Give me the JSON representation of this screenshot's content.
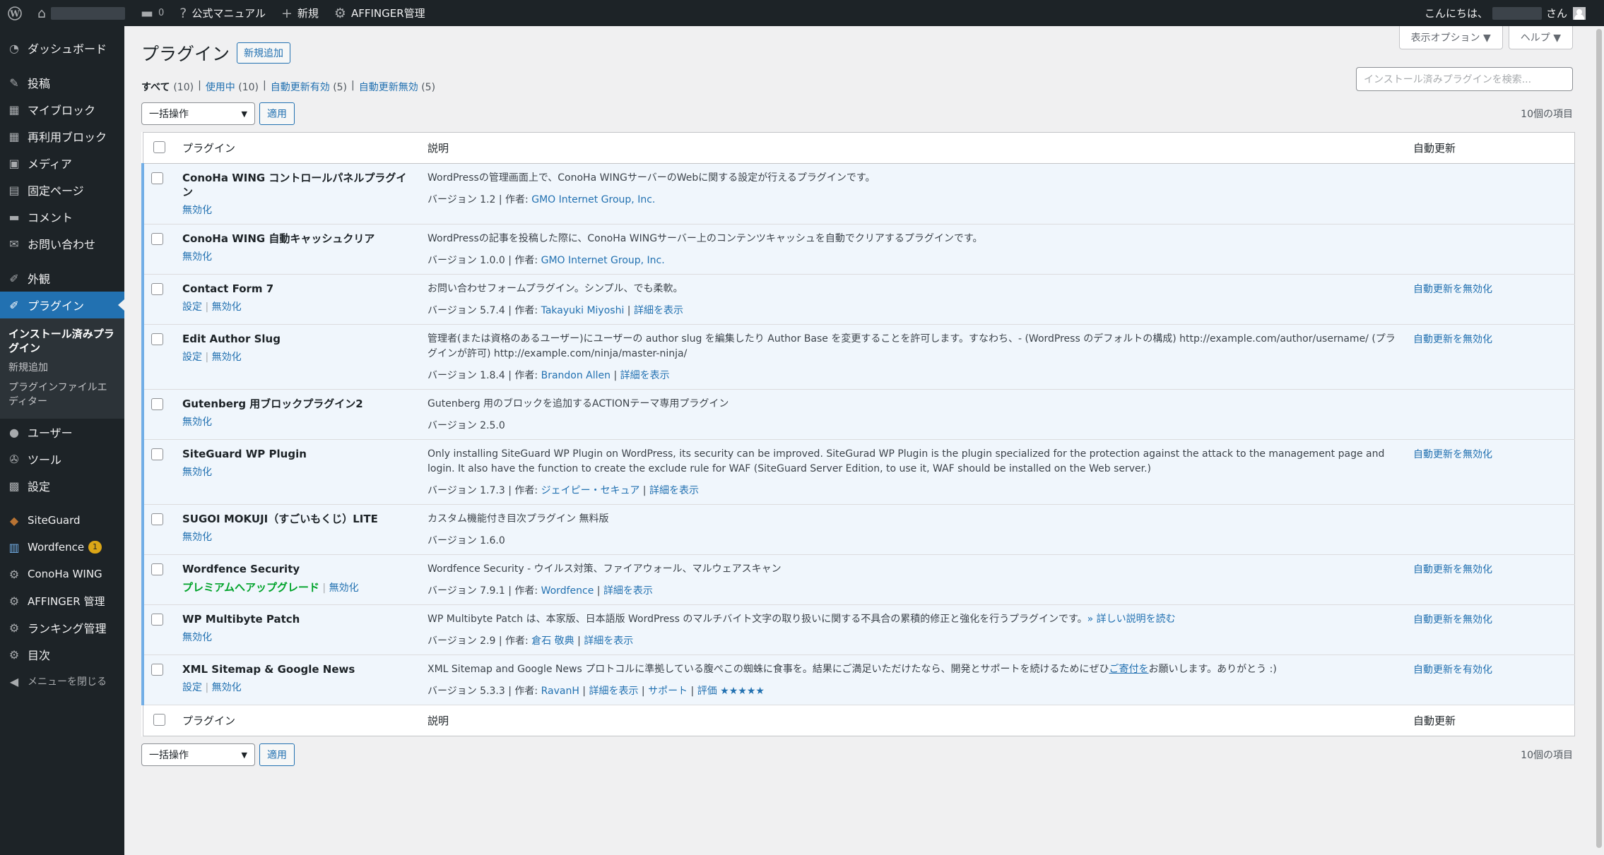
{
  "adminbar": {
    "comments_count": "0",
    "manual_label": "公式マニュアル",
    "new_label": "新規",
    "affinger_label": "AFFINGER管理",
    "greeting": "こんにちは、",
    "greeting_suffix": "さん"
  },
  "sidebar": {
    "items": [
      {
        "label": "ダッシュボード",
        "icon": "dashboard-icon",
        "glyph": "◔"
      },
      {
        "label": "投稿",
        "icon": "pin-icon",
        "glyph": "✎"
      },
      {
        "label": "マイブロック",
        "icon": "grid-icon",
        "glyph": "▦"
      },
      {
        "label": "再利用ブロック",
        "icon": "grid-icon",
        "glyph": "▦"
      },
      {
        "label": "メディア",
        "icon": "media-icon",
        "glyph": "▣"
      },
      {
        "label": "固定ページ",
        "icon": "page-icon",
        "glyph": "▤"
      },
      {
        "label": "コメント",
        "icon": "comment-icon",
        "glyph": "▬"
      },
      {
        "label": "お問い合わせ",
        "icon": "mail-icon",
        "glyph": "✉"
      },
      {
        "label": "外観",
        "icon": "brush-icon",
        "glyph": "✐"
      },
      {
        "label": "プラグイン",
        "icon": "plugin-icon",
        "glyph": "✐"
      },
      {
        "label": "ユーザー",
        "icon": "user-icon",
        "glyph": "●"
      },
      {
        "label": "ツール",
        "icon": "wrench-icon",
        "glyph": "✇"
      },
      {
        "label": "設定",
        "icon": "settings-icon",
        "glyph": "▩"
      },
      {
        "label": "SiteGuard",
        "icon": "siteguard-icon",
        "glyph": "◆"
      },
      {
        "label": "Wordfence",
        "icon": "wordfence-icon",
        "glyph": "▥",
        "badge": "1"
      },
      {
        "label": "ConoHa WING",
        "icon": "gear-icon",
        "glyph": "⚙"
      },
      {
        "label": "AFFINGER 管理",
        "icon": "gear-icon",
        "glyph": "⚙"
      },
      {
        "label": "ランキング管理",
        "icon": "gear-icon",
        "glyph": "⚙"
      },
      {
        "label": "目次",
        "icon": "gear-icon",
        "glyph": "⚙"
      },
      {
        "label": "メニューを閉じる",
        "icon": "collapse-icon",
        "glyph": "◀"
      }
    ],
    "submenu": [
      "インストール済みプラグイン",
      "新規追加",
      "プラグインファイルエディター"
    ]
  },
  "screen_meta": {
    "options": "表示オプション ▼",
    "help": "ヘルプ ▼"
  },
  "page": {
    "title": "プラグイン",
    "add_new": "新規追加",
    "filters": [
      {
        "label": "すべて",
        "count": "(10)"
      },
      {
        "label": "使用中",
        "count": "(10)"
      },
      {
        "label": "自動更新有効",
        "count": "(5)"
      },
      {
        "label": "自動更新無効",
        "count": "(5)"
      }
    ],
    "search_placeholder": "インストール済みプラグインを検索...",
    "bulk_action": "一括操作",
    "apply": "適用",
    "items_count": "10個の項目",
    "columns": {
      "plugin": "プラグイン",
      "description": "説明",
      "auto_update": "自動更新"
    }
  },
  "plugins": [
    {
      "name": "ConoHa WING コントロールパネルプラグイン",
      "actions": [
        "無効化"
      ],
      "desc": "WordPressの管理画面上で、ConoHa WINGサーバーのWebに関する設定が行えるプラグインです。",
      "version": "バージョン 1.2",
      "author_prefix": " | 作者: ",
      "author": "GMO Internet Group, Inc.",
      "extra": [],
      "auto": ""
    },
    {
      "name": "ConoHa WING 自動キャッシュクリア",
      "actions": [
        "無効化"
      ],
      "desc": "WordPressの記事を投稿した際に、ConoHa WINGサーバー上のコンテンツキャッシュを自動でクリアするプラグインです。",
      "version": "バージョン 1.0.0",
      "author_prefix": " | 作者: ",
      "author": "GMO Internet Group, Inc.",
      "extra": [],
      "auto": ""
    },
    {
      "name": "Contact Form 7",
      "actions": [
        "設定",
        "無効化"
      ],
      "desc": "お問い合わせフォームプラグイン。シンプル、でも柔軟。",
      "version": "バージョン 5.7.4",
      "author_prefix": " | 作者: ",
      "author": "Takayuki Miyoshi",
      "extra": [
        "詳細を表示"
      ],
      "auto": "自動更新を無効化"
    },
    {
      "name": "Edit Author Slug",
      "actions": [
        "設定",
        "無効化"
      ],
      "desc": "管理者(または資格のあるユーザー)にユーザーの author slug を編集したり Author Base を変更することを許可します。すなわち、- (WordPress のデフォルトの構成) http://example.com/author/username/ (プラグインが許可) http://example.com/ninja/master-ninja/",
      "version": "バージョン 1.8.4",
      "author_prefix": " | 作者: ",
      "author": "Brandon Allen",
      "extra": [
        "詳細を表示"
      ],
      "auto": "自動更新を無効化"
    },
    {
      "name": "Gutenberg 用ブロックプラグイン2",
      "actions": [
        "無効化"
      ],
      "desc": "Gutenberg 用のブロックを追加するACTIONテーマ専用プラグイン",
      "version": "バージョン 2.5.0",
      "author_prefix": "",
      "author": "",
      "extra": [],
      "auto": ""
    },
    {
      "name": "SiteGuard WP Plugin",
      "actions": [
        "無効化"
      ],
      "desc": "Only installing SiteGuard WP Plugin on WordPress, its security can be improved. SiteGurad WP Plugin is the plugin specialized for the protection against the attack to the management page and login. It also have the function to create the exclude rule for WAF (SiteGuard Server Edition, to use it, WAF should be installed on the Web server.)",
      "version": "バージョン 1.7.3",
      "author_prefix": " | 作者: ",
      "author": "ジェイピー・セキュア",
      "extra": [
        "詳細を表示"
      ],
      "auto": "自動更新を無効化"
    },
    {
      "name": "SUGOI MOKUJI（すごいもくじ）LITE",
      "actions": [
        "無効化"
      ],
      "desc": "カスタム機能付き目次プラグイン 無料版",
      "version": "バージョン 1.6.0",
      "author_prefix": "",
      "author": "",
      "extra": [],
      "auto": ""
    },
    {
      "name": "Wordfence Security",
      "actions": [
        "プレミアムへアップグレード",
        "無効化"
      ],
      "desc": "Wordfence Security - ウイルス対策、ファイアウォール、マルウェアスキャン",
      "version": "バージョン 7.9.1",
      "author_prefix": " | 作者: ",
      "author": "Wordfence",
      "extra": [
        "詳細を表示"
      ],
      "auto": "自動更新を無効化"
    },
    {
      "name": "WP Multibyte Patch",
      "actions": [
        "無効化"
      ],
      "desc": "WP Multibyte Patch は、本家版、日本語版 WordPress のマルチバイト文字の取り扱いに関する不具合の累積的修正と強化を行うプラグインです。",
      "desc_link": "» 詳しい説明を読む",
      "version": "バージョン 2.9",
      "author_prefix": " | 作者: ",
      "author": "倉石 敬典",
      "extra": [
        "詳細を表示"
      ],
      "auto": "自動更新を無効化"
    },
    {
      "name": "XML Sitemap & Google News",
      "actions": [
        "設定",
        "無効化"
      ],
      "desc": "XML Sitemap and Google News プロトコルに準拠している腹ぺこの蜘蛛に食事を。結果にご満足いただけたなら、開発とサポートを続けるためにぜひ",
      "desc_link": "ご寄付を",
      "desc_after": "お願いします。ありがとう :)",
      "version": "バージョン 5.3.3",
      "author_prefix": " | 作者: ",
      "author": "RavanH",
      "extra": [
        "詳細を表示",
        "サポート",
        "評価 ★★★★★"
      ],
      "auto": "自動更新を有効化"
    }
  ]
}
